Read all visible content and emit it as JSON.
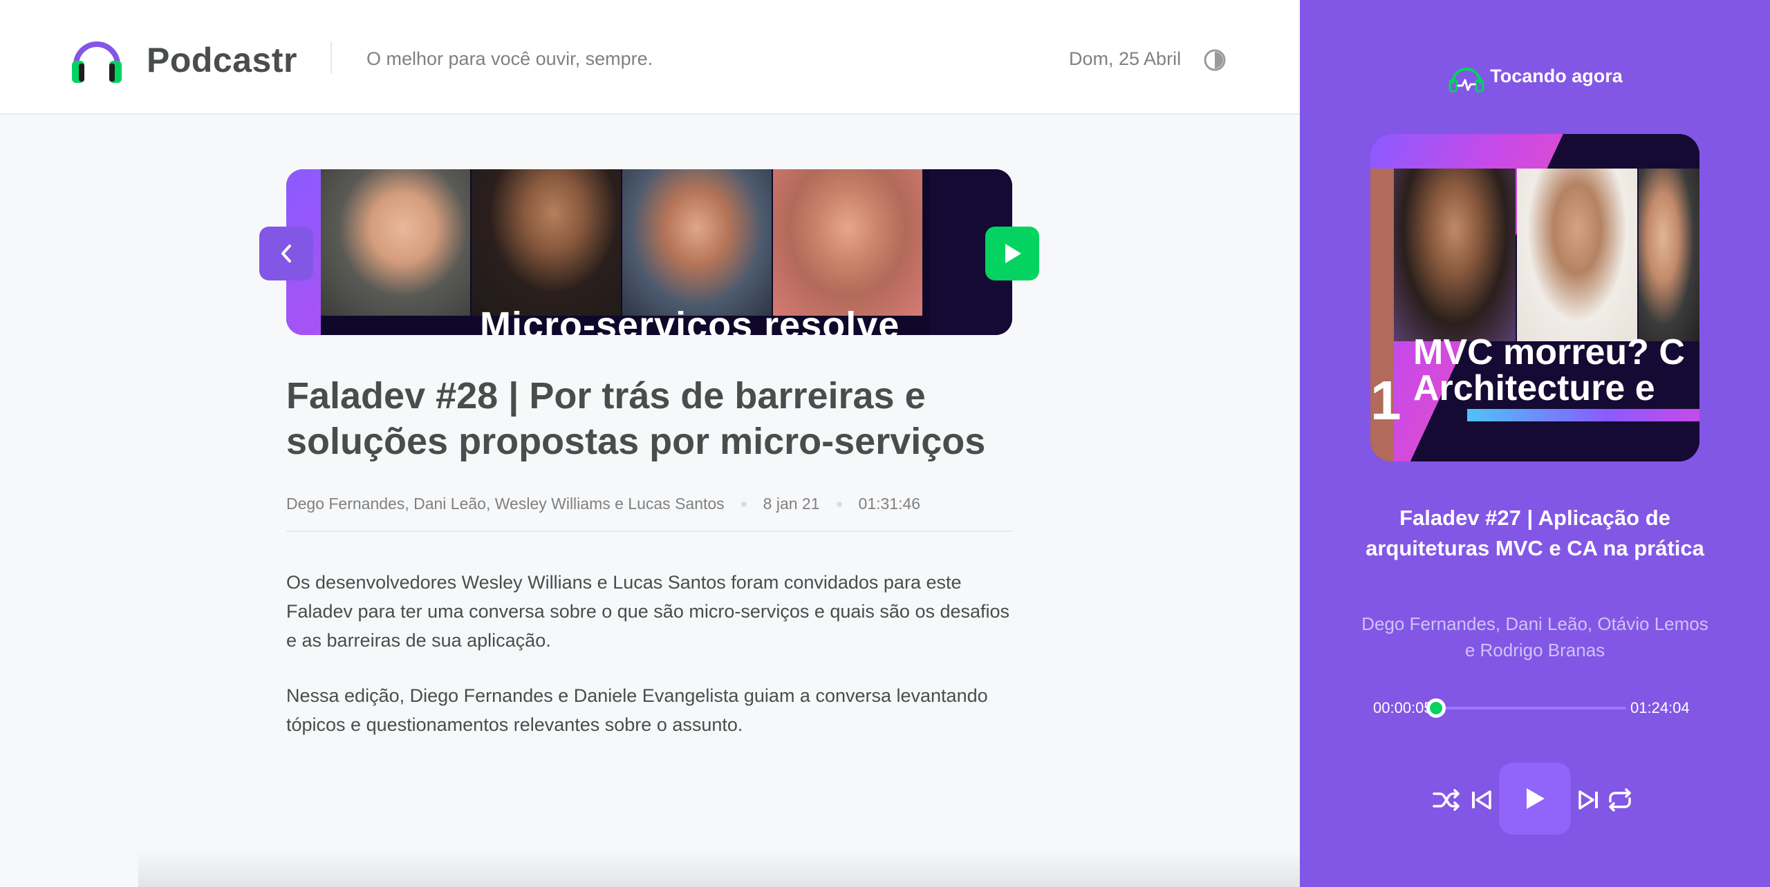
{
  "header": {
    "app_name": "Podcastr",
    "tagline": "O melhor para você ouvir, sempre.",
    "date": "Dom, 25 Abril",
    "theme_toggle_icon": "half-circle-icon"
  },
  "episode": {
    "thumbnail_caption": "Micro-serviços resolve",
    "title": "Faladev #28 | Por trás de barreiras e soluções propostas por micro-serviços",
    "members": "Dego Fernandes, Dani Leão, Wesley Williams e Lucas Santos",
    "published_at": "8 jan 21",
    "duration": "01:31:46",
    "description": [
      "Os desenvolvedores Wesley Willians e Lucas Santos foram convidados para este Faladev para ter uma conversa sobre o que são micro-serviços e quais são os desafios e as barreiras de sua aplicação.",
      "Nessa edição, Diego Fernandes e Daniele Evangelista guiam a conversa levantando tópicos e questionamentos relevantes sobre o assunto."
    ]
  },
  "player": {
    "header_label": "Tocando agora",
    "cover_caption_line1": "MVC morreu? C",
    "cover_caption_line2": "Architecture e",
    "cover_number": "1",
    "title": "Faladev #27 | Aplicação de arquiteturas MVC e CA na prática",
    "members": "Dego Fernandes, Dani Leão, Otávio Lemos e Rodrigo Branas",
    "current_time": "00:00:05",
    "total_time": "01:24:04",
    "progress_fraction": 0.001,
    "controls": [
      "shuffle-icon",
      "previous-icon",
      "play-icon",
      "next-icon",
      "repeat-icon"
    ]
  },
  "colors": {
    "purple": "#8257e5",
    "green": "#04d361",
    "text": "#494d4b",
    "muted": "#808080"
  }
}
